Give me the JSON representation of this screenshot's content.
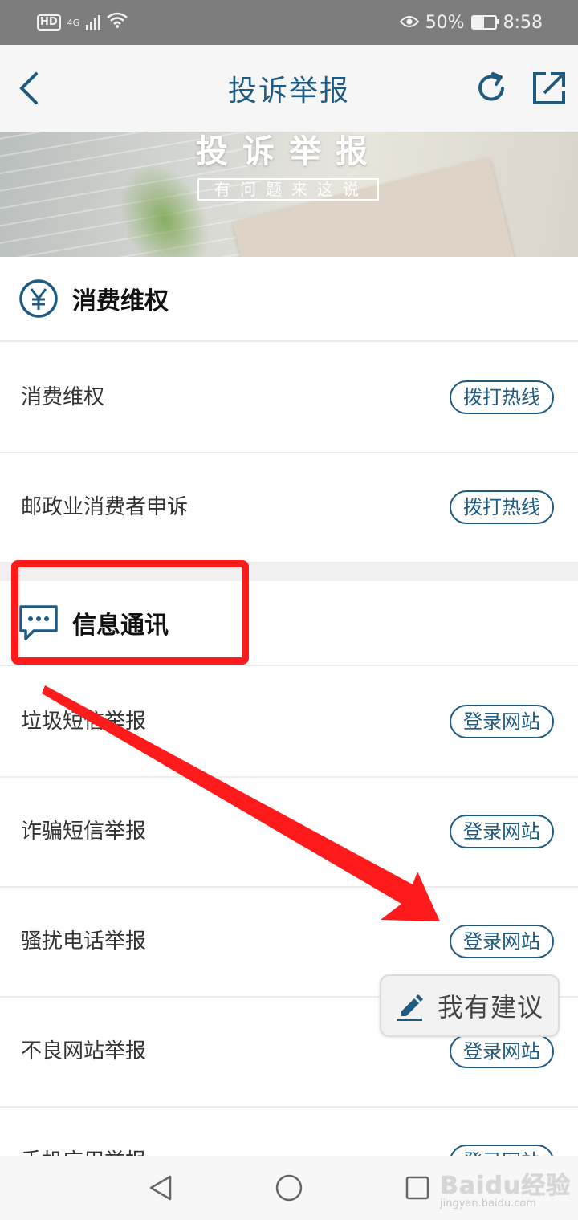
{
  "status_bar": {
    "hd": "HD",
    "network": "4G",
    "battery": "50%",
    "time": "8:58",
    "battery_level": 0.5
  },
  "header": {
    "title": "投诉举报"
  },
  "banner": {
    "title": "投诉举报",
    "subtitle": "有问题来这说"
  },
  "sections": [
    {
      "title": "消费维权",
      "icon": "yen-icon",
      "items": [
        {
          "label": "消费维权",
          "action": "拨打热线"
        },
        {
          "label": "邮政业消费者申诉",
          "action": "拨打热线"
        }
      ]
    },
    {
      "title": "信息通讯",
      "icon": "chat-bubble-icon",
      "items": [
        {
          "label": "垃圾短信举报",
          "action": "登录网站"
        },
        {
          "label": "诈骗短信举报",
          "action": "登录网站"
        },
        {
          "label": "骚扰电话举报",
          "action": "登录网站"
        },
        {
          "label": "不良网站举报",
          "action": "登录网站"
        },
        {
          "label": "手机应用举报",
          "action": "登录网站"
        }
      ]
    }
  ],
  "floating": {
    "suggest_label": "我有建议"
  },
  "watermark": {
    "brand": "Baidu经验",
    "url": "jingyan.baidu.com"
  },
  "colors": {
    "accent": "#1f5a80",
    "annotation": "#ff1b1b"
  }
}
